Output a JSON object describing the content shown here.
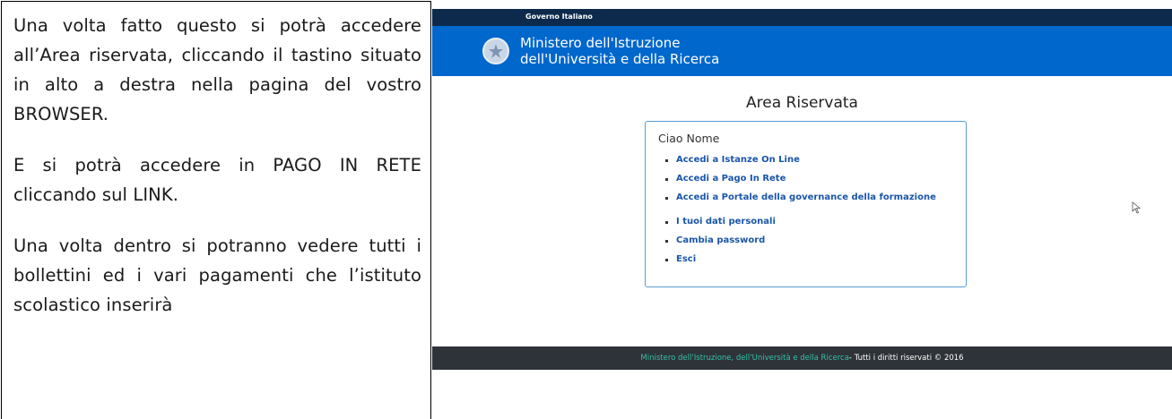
{
  "left_text": {
    "paragraphs": [
      "Una volta fatto questo si potrà accedere all’Area riservata, cliccando il tastino situato in alto a destra nella pagina del vostro BROWSER.",
      "E si potrà accedere in PAGO IN RETE cliccando sul LINK.",
      "Una volta dentro si potranno vedere tutti i bollettini ed i vari pagamenti che l’istituto scolastico inserirà"
    ]
  },
  "screenshot": {
    "gov_bar": "Governo Italiano",
    "ministry_line1": "Ministero dell'Istruzione",
    "ministry_line2": "dell'Università e della Ricerca",
    "page_title": "Area Riservata",
    "greeting": "Ciao Nome",
    "links": [
      "Accedi a Istanze On Line",
      "Accedi a Pago In Rete",
      "Accedi a Portale della governance della formazione",
      "I tuoi dati personali",
      "Cambia password",
      "Esci"
    ],
    "footer_link": "Ministero dell'Istruzione, dell'Università e della Ricerca",
    "footer_rest": " - Tutti i diritti riservati © 2016",
    "colors": {
      "gov_bar": "#0d2a4c",
      "ministry_bar": "#0067cc",
      "link": "#1a55a8",
      "footer": "#2e3339",
      "footer_link": "#35c1a4"
    },
    "icons": [
      "ministry-emblem-icon",
      "mouse-cursor-icon"
    ]
  }
}
